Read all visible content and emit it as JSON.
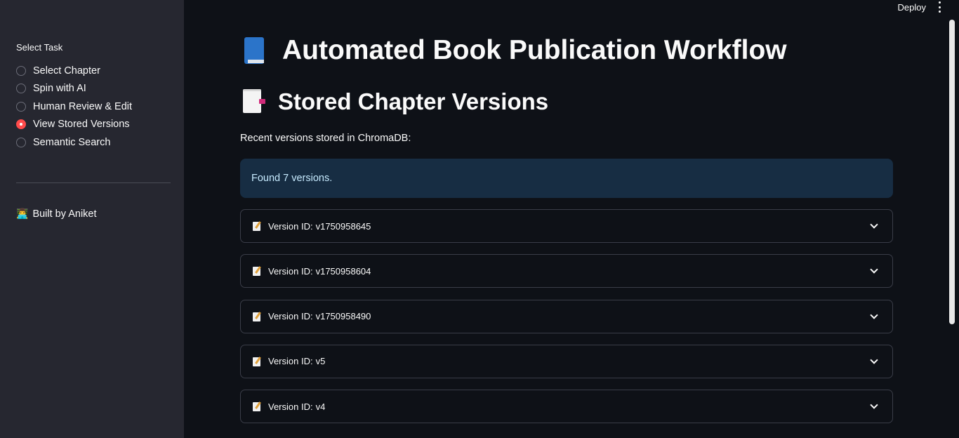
{
  "sidebar": {
    "label": "Select Task",
    "options": [
      {
        "label": "Select Chapter",
        "selected": false
      },
      {
        "label": "Spin with AI",
        "selected": false
      },
      {
        "label": "Human Review & Edit",
        "selected": false
      },
      {
        "label": "View Stored Versions",
        "selected": true
      },
      {
        "label": "Semantic Search",
        "selected": false
      }
    ],
    "credit_icon": "person-icon",
    "credit_text": "Built by Aniket"
  },
  "header": {
    "deploy_label": "Deploy",
    "menu_icon": "kebab-menu-icon"
  },
  "main": {
    "title": "Automated Book Publication Workflow",
    "title_icon": "blue-book-icon",
    "section_title": "Stored Chapter Versions",
    "section_icon": "document-icon",
    "description": "Recent versions stored in ChromaDB:",
    "info": "Found 7 versions.",
    "versions": [
      {
        "prefix": "Version ID:",
        "id": "v1750958645"
      },
      {
        "prefix": "Version ID:",
        "id": "v1750958604"
      },
      {
        "prefix": "Version ID:",
        "id": "v1750958490"
      },
      {
        "prefix": "Version ID:",
        "id": "v5"
      },
      {
        "prefix": "Version ID:",
        "id": "v4"
      }
    ]
  },
  "colors": {
    "background": "#0e1117",
    "sidebar": "#262730",
    "accent": "#ff4b4b",
    "info_background": "#172d43",
    "info_text": "#c7ebff"
  }
}
